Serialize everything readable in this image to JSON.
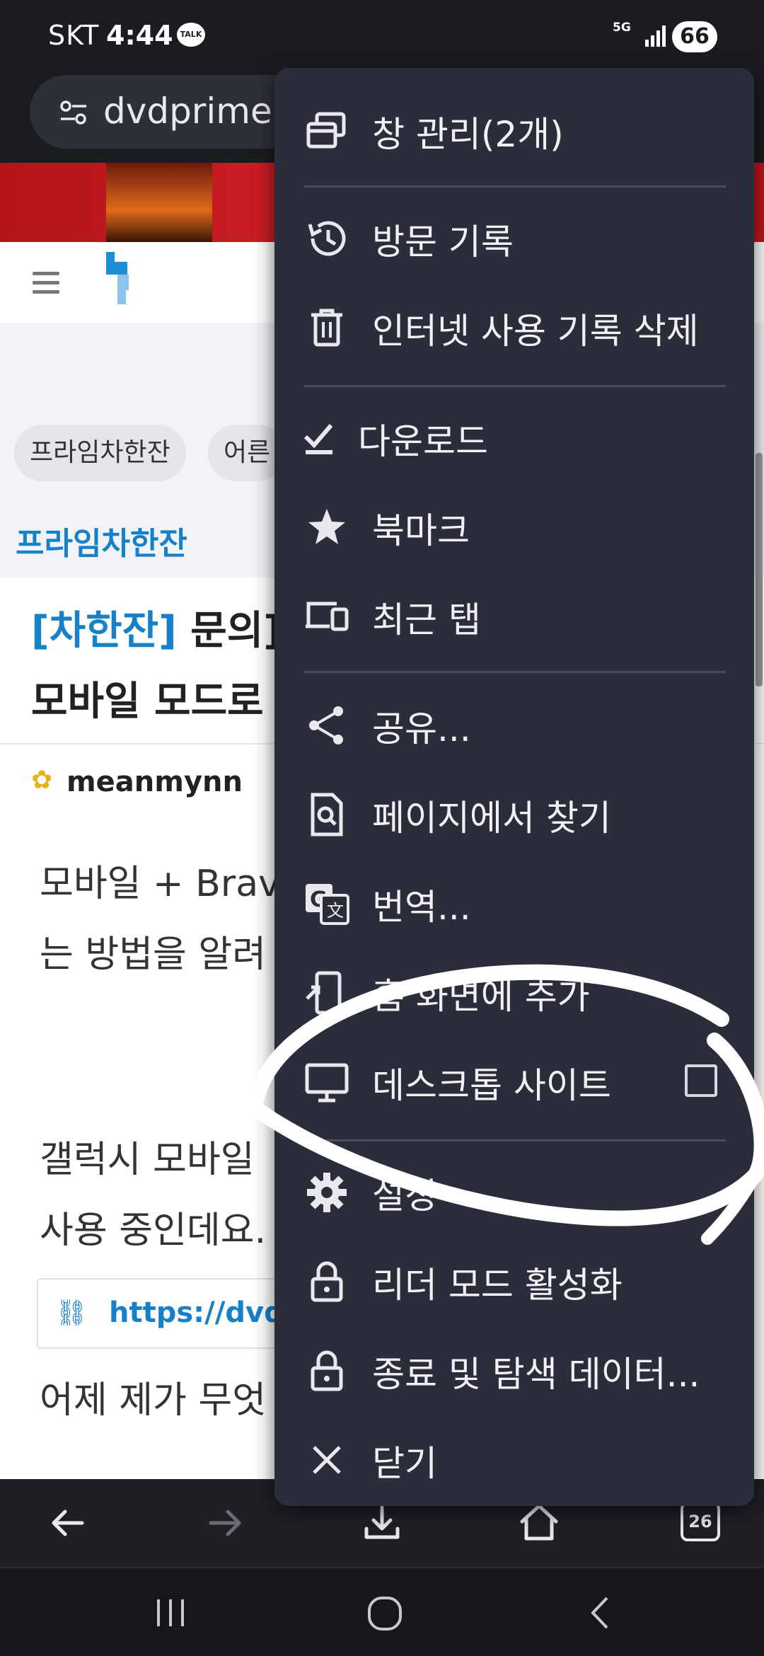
{
  "status_bar": {
    "carrier": "SKT",
    "time": "4:44",
    "talk_badge": "TALK",
    "network": "5G",
    "battery": "66"
  },
  "address_bar": {
    "url": "dvdprime.c"
  },
  "page": {
    "chips": [
      "프라임차한잔",
      "어른"
    ],
    "category": "프라임차한잔",
    "title_tag": "[차한잔]",
    "title_line1_rest": "문의]",
    "title_line2": "모바일 모드로",
    "author": "meanmynn",
    "body_line1": "모바일 + Brave",
    "body_line2": "는 방법을 알려",
    "body_line3": "갤럭시 모바일",
    "body_line4": "사용 중인데요.",
    "link_text": "https://dvdpr",
    "body_line5": "어제 제가 무엇"
  },
  "menu": {
    "items": [
      {
        "label": "창 관리(2개)",
        "icon": "window-manage-icon"
      },
      {
        "label": "방문 기록",
        "icon": "history-icon"
      },
      {
        "label": "인터넷 사용 기록 삭제",
        "icon": "trash-icon"
      },
      {
        "label": "다운로드",
        "icon": "download-check-icon"
      },
      {
        "label": "북마크",
        "icon": "star-icon"
      },
      {
        "label": "최근 탭",
        "icon": "devices-icon"
      },
      {
        "label": "공유...",
        "icon": "share-icon"
      },
      {
        "label": "페이지에서 찾기",
        "icon": "find-in-page-icon"
      },
      {
        "label": "번역...",
        "icon": "translate-icon"
      },
      {
        "label": "홈 화면에 추가",
        "icon": "add-to-home-icon"
      },
      {
        "label": "데스크톱 사이트",
        "icon": "desktop-icon",
        "checked": false
      },
      {
        "label": "설정",
        "icon": "gear-icon"
      },
      {
        "label": "리더 모드 활성화",
        "icon": "lock-icon"
      },
      {
        "label": "종료 및 탐색 데이터...",
        "icon": "lock-icon"
      },
      {
        "label": "닫기",
        "icon": "close-icon"
      }
    ]
  },
  "bottom_bar": {
    "tab_count": "26"
  },
  "colors": {
    "menu_bg": "#2b2d3a",
    "accent_blue": "#1680c9",
    "banner_red": "#d8232a"
  }
}
